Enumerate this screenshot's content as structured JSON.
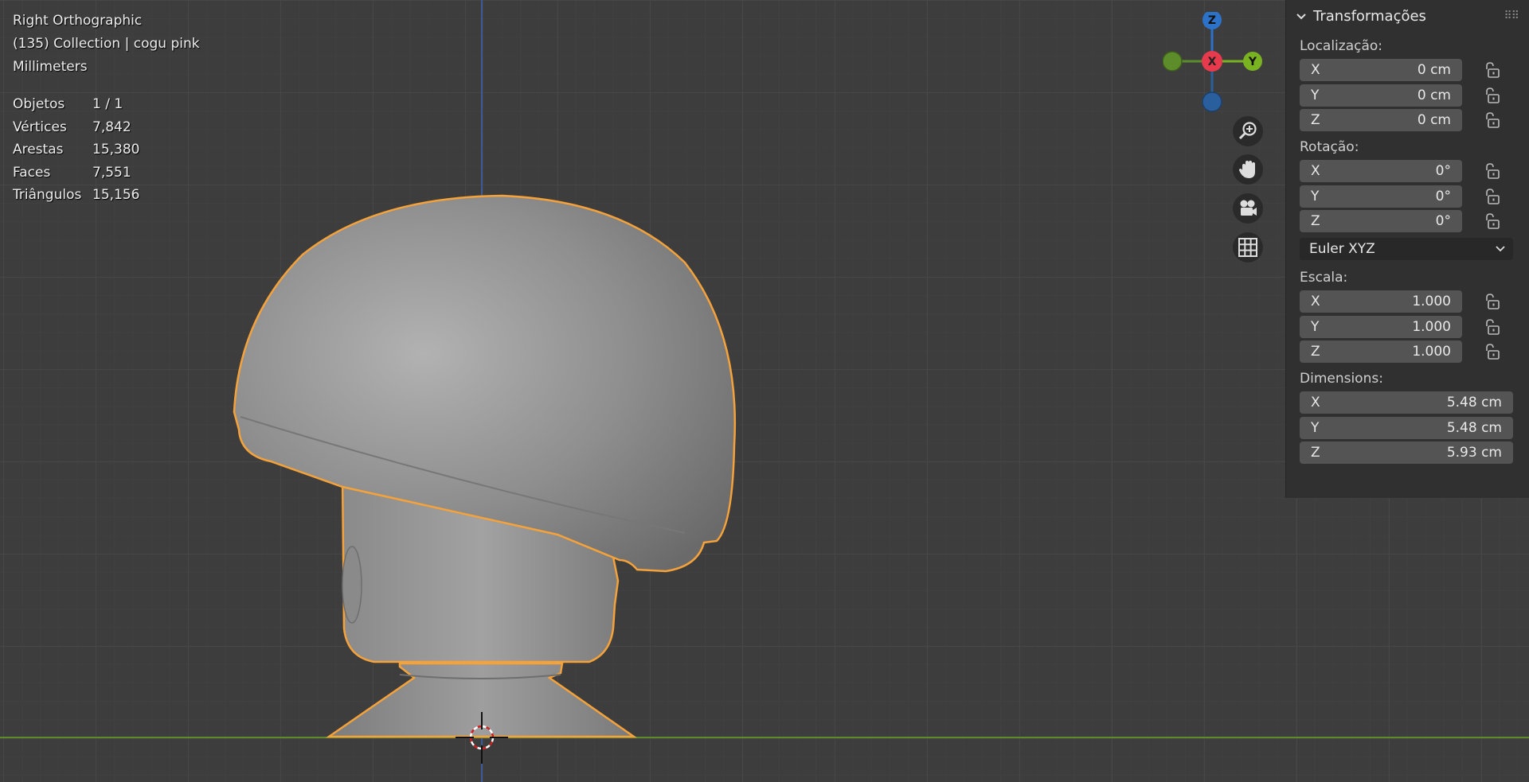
{
  "viewport": {
    "view_name": "Right Orthographic",
    "collection_line": "(135) Collection | cogu pink",
    "units": "Millimeters",
    "stats": [
      {
        "label": "Objetos",
        "value": "1 / 1"
      },
      {
        "label": "Vértices",
        "value": "7,842"
      },
      {
        "label": "Arestas",
        "value": "15,380"
      },
      {
        "label": "Faces",
        "value": "7,551"
      },
      {
        "label": "Triângulos",
        "value": "15,156"
      }
    ]
  },
  "gizmo": {
    "z_label": "Z",
    "x_label": "X",
    "y_label": "Y",
    "colors": {
      "x": "#e83a4d",
      "y": "#7ab322",
      "z": "#2d72c9",
      "neg_y": "#5d8c2a",
      "neg_z": "#2a5f9e"
    }
  },
  "nav_buttons": [
    "zoom-icon",
    "hand-pan-icon",
    "camera-icon",
    "grid-icon"
  ],
  "panel": {
    "title": "Transformações",
    "location": {
      "label": "Localização:",
      "x": {
        "axis": "X",
        "value": "0 cm"
      },
      "y": {
        "axis": "Y",
        "value": "0 cm"
      },
      "z": {
        "axis": "Z",
        "value": "0 cm"
      }
    },
    "rotation": {
      "label": "Rotação:",
      "x": {
        "axis": "X",
        "value": "0°"
      },
      "y": {
        "axis": "Y",
        "value": "0°"
      },
      "z": {
        "axis": "Z",
        "value": "0°"
      },
      "mode": "Euler XYZ"
    },
    "scale": {
      "label": "Escala:",
      "x": {
        "axis": "X",
        "value": "1.000"
      },
      "y": {
        "axis": "Y",
        "value": "1.000"
      },
      "z": {
        "axis": "Z",
        "value": "1.000"
      }
    },
    "dimensions": {
      "label": "Dimensions:",
      "x": {
        "axis": "X",
        "value": "5.48 cm"
      },
      "y": {
        "axis": "Y",
        "value": "5.48 cm"
      },
      "z": {
        "axis": "Z",
        "value": "5.93 cm"
      }
    }
  },
  "colors": {
    "selection_outline": "#f5a23a",
    "background": "#3d3d3d"
  }
}
